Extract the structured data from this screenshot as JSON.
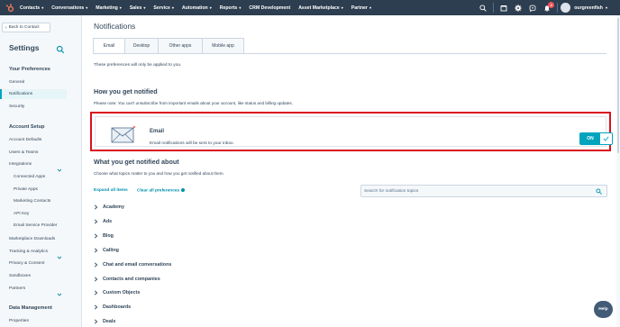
{
  "topnav": {
    "items": [
      {
        "label": "Contacts"
      },
      {
        "label": "Conversations"
      },
      {
        "label": "Marketing"
      },
      {
        "label": "Sales"
      },
      {
        "label": "Service"
      },
      {
        "label": "Automation"
      },
      {
        "label": "Reports"
      },
      {
        "label": "CRM Development"
      },
      {
        "label": "Asset Marketplace"
      },
      {
        "label": "Partner"
      }
    ],
    "notification_count": "2",
    "account_name": "ourgreenfish",
    "colors": {
      "bg": "#2d3e50",
      "brand": "#ff7a59",
      "badge": "#f2545b"
    }
  },
  "sidebar": {
    "back_label": "Back to Contact",
    "title": "Settings",
    "sections": [
      {
        "heading": "Your Preferences",
        "items": [
          "General",
          "Notifications",
          "Security"
        ]
      },
      {
        "heading": "Account Setup",
        "items": [
          "Account Defaults",
          "Users & Teams",
          "Integrations",
          "Connected Apps",
          "Private Apps",
          "Marketing Contacts",
          "API Key",
          "Email Service Provider",
          "Marketplace Downloads",
          "Tracking & Analytics",
          "Privacy & Consent",
          "Sandboxes",
          "Partners"
        ]
      },
      {
        "heading": "Data Management",
        "items": [
          "Properties"
        ]
      }
    ],
    "active_item": "Notifications"
  },
  "main": {
    "title": "Notifications",
    "tabs": [
      {
        "label": "Email"
      },
      {
        "label": "Desktop"
      },
      {
        "label": "Other apps"
      },
      {
        "label": "Mobile app"
      }
    ],
    "note": "These preferences will only be applied to you.",
    "how_heading": "How you get notified",
    "how_sub": "Please note: You can't unsubscribe from important emails about your account, like status and billing updates.",
    "email_card": {
      "title": "Email",
      "description": "Email notifications will be sent to your inbox.",
      "toggle_label": "ON"
    },
    "what_heading": "What you get notified about",
    "what_sub": "Choose what topics matter to you and how you get notified about them.",
    "expand_all": "Expand all items",
    "clear_all": "Clear all preferences",
    "search_placeholder": "Search for notification topics",
    "topics": [
      "Academy",
      "Ads",
      "Blog",
      "Calling",
      "Chat and email conversations",
      "Contacts and companies",
      "Custom Objects",
      "Dashboards",
      "Deals"
    ]
  },
  "help_label": "Help",
  "accent_color": "#00a4bd",
  "highlight_color": "#d9121f"
}
